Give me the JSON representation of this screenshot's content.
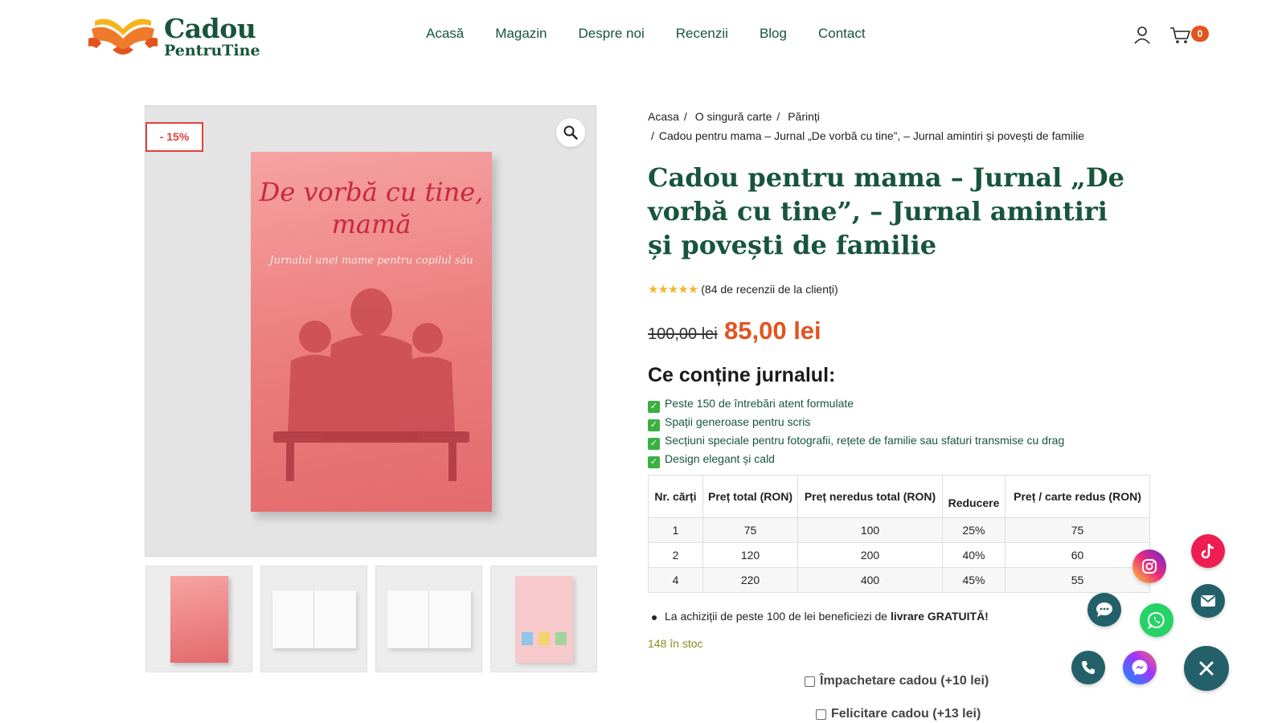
{
  "header": {
    "logo_line1": "Cadou",
    "logo_line2": "PentruTine",
    "nav": [
      "Acasă",
      "Magazin",
      "Despre noi",
      "Recenzii",
      "Blog",
      "Contact"
    ],
    "cart_count": "0"
  },
  "gallery": {
    "sale_badge": "- 15%",
    "book_title": "De vorbă cu tine, mamă",
    "book_subtitle": "Jurnalul unei mame pentru copilul său",
    "thumb_count": 4
  },
  "product": {
    "breadcrumb": [
      "Acasa",
      "O singură carte",
      "Părinți",
      "Cadou pentru mama – Jurnal „De vorbă cu tine”, – Jurnal amintiri și povești de familie"
    ],
    "title": "Cadou pentru mama – Jurnal „De vorbă cu tine”, – Jurnal amintiri și povești de familie",
    "rating_text": "(84 de recenzii de la clienți)",
    "stars": 5,
    "price_old": "100,00 lei",
    "price_new": "85,00 lei",
    "contents_title": "Ce conține jurnalul:",
    "features": [
      "Peste 150 de întrebări atent formulate",
      "Spații generoase pentru scris",
      "Secțiuni speciale pentru fotografii, rețete de familie sau sfaturi transmise cu drag",
      "Design elegant și cald"
    ],
    "table": {
      "headers": [
        "Nr. cărți",
        "Preț total (RON)",
        "Preț neredus total (RON)",
        "Reducere",
        "Preț / carte redus (RON)"
      ],
      "rows": [
        [
          "1",
          "75",
          "100",
          "25%",
          "75"
        ],
        [
          "2",
          "120",
          "200",
          "40%",
          "60"
        ],
        [
          "4",
          "220",
          "400",
          "45%",
          "55"
        ]
      ]
    },
    "delivery_text": "La achiziții de peste 100 de lei beneficiezi de ",
    "delivery_bold": "livrare GRATUITĂ!",
    "stock": "148 în stoc",
    "option_gift_wrap": "Împachetare cadou (+10 lei)",
    "option_card": "Felicitare cadou (+13 lei)"
  },
  "colors": {
    "brand_green": "#17553c",
    "accent_orange": "#e2541e",
    "sale_red": "#e0423b",
    "fab_teal": "#23606a"
  }
}
